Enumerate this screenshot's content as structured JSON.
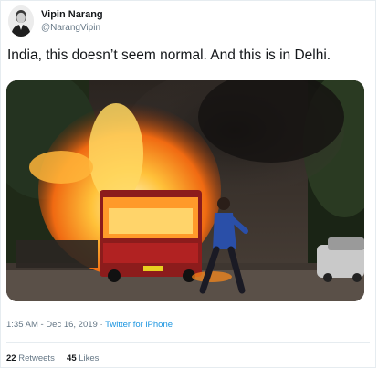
{
  "author": {
    "name": "Vipin Narang",
    "handle": "@NarangVipin"
  },
  "tweet": {
    "text": "India, this doesn’t seem normal. And this is in Delhi."
  },
  "meta": {
    "time": "1:35 AM - Dec 16, 2019",
    "separator": " · ",
    "source": "Twitter for iPhone"
  },
  "stats": {
    "retweets_count": "22",
    "retweets_label": "Retweets",
    "likes_count": "45",
    "likes_label": "Likes"
  },
  "colors": {
    "link": "#1b95e0",
    "muted": "#657786",
    "text": "#14171a"
  }
}
